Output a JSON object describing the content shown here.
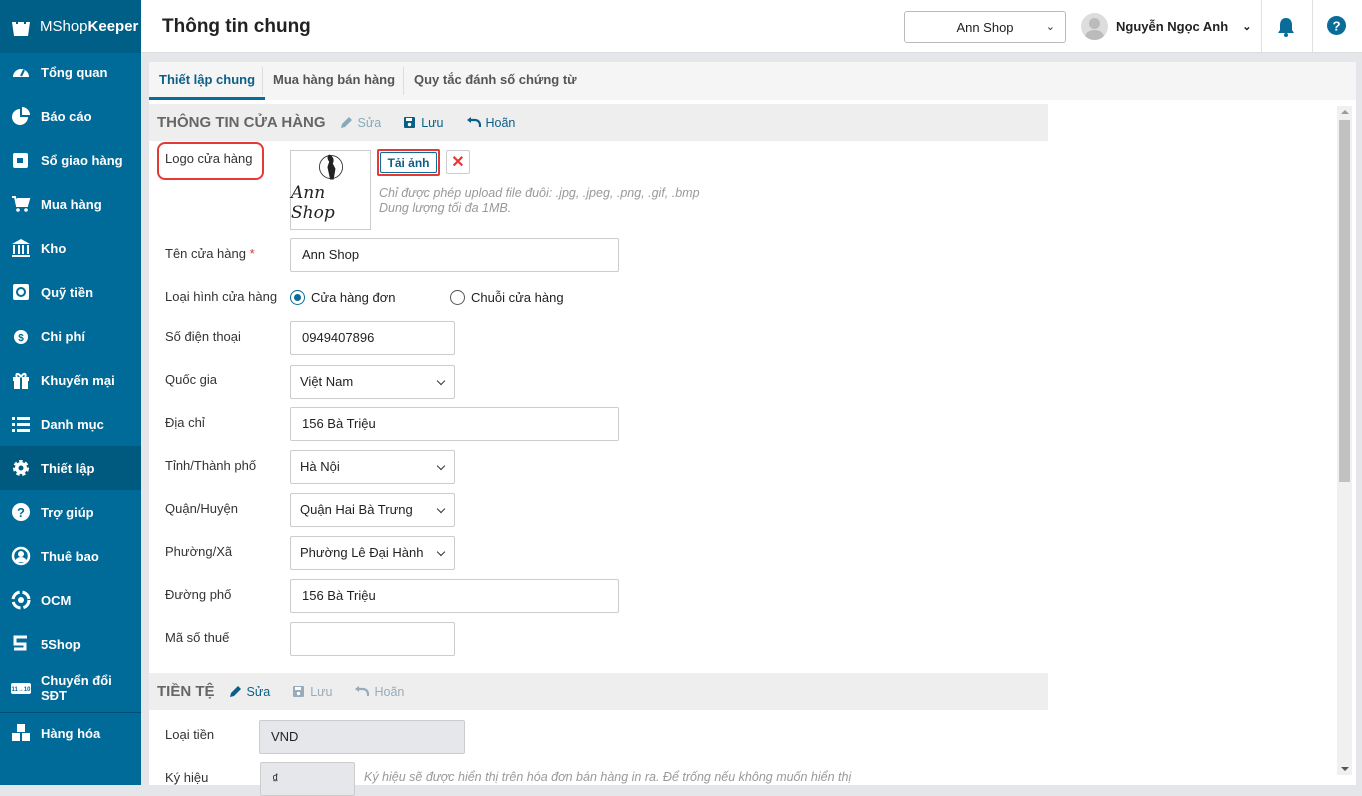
{
  "brand": {
    "name_light": "MShop",
    "name_bold": "Keeper"
  },
  "sidebar": {
    "items": [
      {
        "label": "Tổng quan",
        "icon": "dashboard-icon"
      },
      {
        "label": "Báo cáo",
        "icon": "pie-chart-icon"
      },
      {
        "label": "Sổ giao hàng",
        "icon": "delivery-icon"
      },
      {
        "label": "Mua hàng",
        "icon": "cart-icon"
      },
      {
        "label": "Kho",
        "icon": "warehouse-icon"
      },
      {
        "label": "Quỹ tiền",
        "icon": "safe-icon"
      },
      {
        "label": "Chi phí",
        "icon": "money-icon"
      },
      {
        "label": "Khuyến mại",
        "icon": "gift-icon"
      },
      {
        "label": "Danh mục",
        "icon": "list-icon"
      },
      {
        "label": "Thiết lập",
        "icon": "gear-icon",
        "active": true
      },
      {
        "label": "Trợ giúp",
        "icon": "help-icon"
      },
      {
        "label": "Thuê bao",
        "icon": "user-circle-icon"
      },
      {
        "label": "OCM",
        "icon": "ocm-icon"
      },
      {
        "label": "5Shop",
        "icon": "5shop-icon"
      },
      {
        "label": "Chuyển đổi SĐT",
        "icon": "phone-convert-icon"
      },
      {
        "label": "Hàng hóa",
        "icon": "boxes-icon"
      }
    ]
  },
  "header": {
    "title": "Thông tin chung",
    "shop": "Ann Shop",
    "user": "Nguyễn Ngọc Anh"
  },
  "tabs": [
    "Thiết lập chung",
    "Mua hàng bán hàng",
    "Quy tắc đánh số chứng từ"
  ],
  "store": {
    "title": "THÔNG TIN CỬA HÀNG",
    "edit": "Sửa",
    "save": "Lưu",
    "cancel": "Hoãn",
    "logo_label": "Logo cửa hàng",
    "logo_text": "Ann Shop",
    "upload": "Tải ảnh",
    "hint1": "Chỉ được phép upload file đuôi: .jpg, .jpeg, .png, .gif, .bmp",
    "hint2": "Dung lượng tối đa 1MB.",
    "name_label": "Tên cửa hàng",
    "name": "Ann Shop",
    "type_label": "Loại hình cửa hàng",
    "type_single": "Cửa hàng đơn",
    "type_chain": "Chuỗi cửa hàng",
    "phone_label": "Số điện thoại",
    "phone": "0949407896",
    "country_label": "Quốc gia",
    "country": "Việt Nam",
    "address_label": "Địa chỉ",
    "address": "156 Bà Triệu",
    "city_label": "Tỉnh/Thành phố",
    "city": "Hà Nội",
    "district_label": "Quận/Huyện",
    "district": "Quận Hai Bà Trưng",
    "ward_label": "Phường/Xã",
    "ward": "Phường Lê Đại Hành",
    "street_label": "Đường phố",
    "street": "156 Bà Triệu",
    "tax_label": "Mã số thuế",
    "tax": ""
  },
  "currency": {
    "title": "TIỀN TỆ",
    "edit": "Sửa",
    "save": "Lưu",
    "cancel": "Hoãn",
    "type_label": "Loại tiền",
    "type": "VND",
    "symbol_label": "Ký hiệu",
    "symbol": "₫",
    "symbol_hint": "Ký hiệu sẽ được hiển thị trên hóa đơn bán hàng in ra. Để trống nếu không muốn hiển thị"
  },
  "colors": {
    "sidebar": "#006b99",
    "accent": "#0b6b99",
    "danger": "#e53935"
  }
}
